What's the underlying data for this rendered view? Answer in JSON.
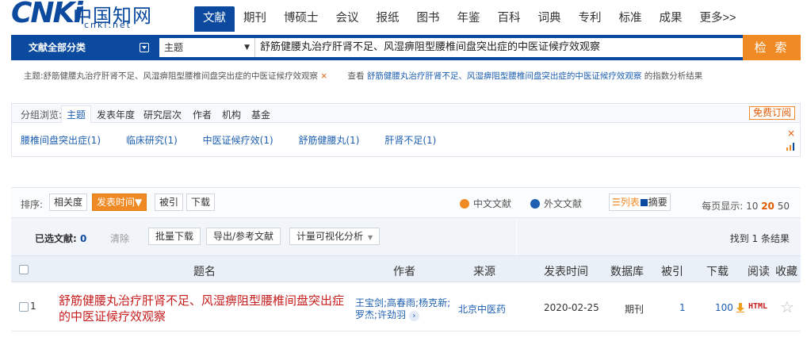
{
  "logo": {
    "brand": "CNKi",
    "chars": "中国知网",
    "site": "cnki.net"
  },
  "nav": {
    "items": [
      "文献",
      "期刊",
      "博硕士",
      "会议",
      "报纸",
      "图书",
      "年鉴",
      "百科",
      "词典",
      "专利",
      "标准",
      "成果",
      "更多>>"
    ]
  },
  "search": {
    "all_categories": "文献全部分类",
    "field": "主题",
    "query": "舒筋健腰丸治疗肝肾不足、风湿痹阻型腰椎间盘突出症的中医证候疗效观察",
    "button": "检 索"
  },
  "summary": {
    "prefix": "主题:舒筋健腰丸治疗肝肾不足、风湿痹阻型腰椎间盘突出症的中医证候疗效观察",
    "remove": "×",
    "view_prefix": "查看",
    "view_link": "舒筋健腰丸治疗肝肾不足、风湿痹阻型腰椎间盘突出症的中医证候疗效观察",
    "view_suffix": "的指数分析结果"
  },
  "group": {
    "label": "分组浏览:",
    "tabs": [
      "主题",
      "发表年度",
      "研究层次",
      "作者",
      "机构",
      "基金"
    ],
    "subscribe": "免费订阅",
    "items": [
      "腰椎间盘突出症(1)",
      "临床研究(1)",
      "中医证候疗效(1)",
      "舒筋健腰丸(1)",
      "肝肾不足(1)"
    ],
    "close": "×"
  },
  "sort": {
    "label": "排序:",
    "options": [
      "相关度",
      "发表时间",
      "被引",
      "下载"
    ],
    "chinese_docs": "中文文献",
    "foreign_docs": "外文文献",
    "view_list": "列表",
    "view_abstract": "摘要",
    "per_page_label": "每页显示:",
    "per_page": [
      "10",
      "20",
      "50"
    ]
  },
  "selection": {
    "selected_label": "已选文献:",
    "selected_count": "0",
    "clear": "清除",
    "actions": [
      "批量下载",
      "导出/参考文献",
      "计量可视化分析"
    ],
    "found": "找到 1 条结果"
  },
  "table": {
    "headers": [
      "题名",
      "作者",
      "来源",
      "发表时间",
      "数据库",
      "被引",
      "下载",
      "阅读",
      "收藏"
    ],
    "rows": [
      {
        "num": "1",
        "title": "舒筋健腰丸治疗肝肾不足、风湿痹阻型腰椎间盘突出症的中医证候疗效观察",
        "authors_line1": "王宝剑;高春雨;杨克新;",
        "authors_line2": "罗杰;许劲羽",
        "source": "北京中医药",
        "date": "2020-02-25",
        "database": "期刊",
        "cites": "1",
        "downloads": "100",
        "read": "HTML"
      }
    ]
  },
  "colors": {
    "brand_blue": "#0b4a9e",
    "accent_orange": "#f08a24",
    "title_red": "#c61c1c",
    "link_blue": "#1d5fb0"
  }
}
